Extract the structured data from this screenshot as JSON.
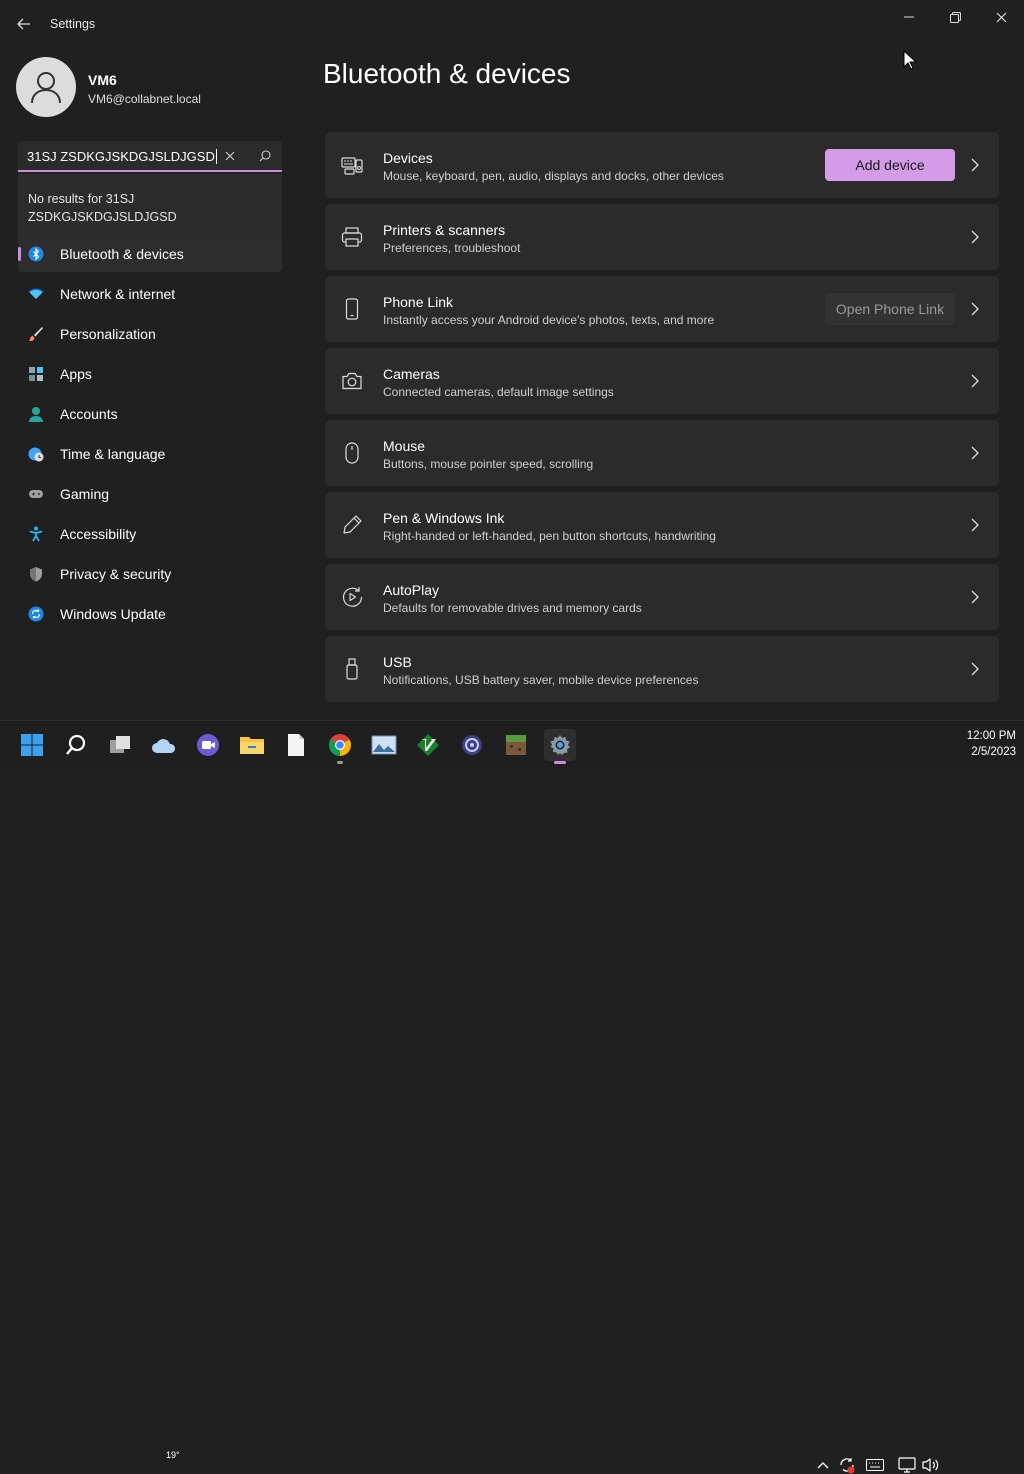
{
  "window": {
    "title": "Settings"
  },
  "user": {
    "name": "VM6",
    "email": "VM6@collabnet.local"
  },
  "search": {
    "value": "31SJ ZSDKGJSKDGJSLDJGSD",
    "no_results": "No results for 31SJ ZSDKGJSKDGJSLDJGSD"
  },
  "nav": [
    {
      "label": "Bluetooth & devices",
      "icon": "bluetooth-icon",
      "selected": true
    },
    {
      "label": "Network & internet",
      "icon": "wifi-icon"
    },
    {
      "label": "Personalization",
      "icon": "brush-icon"
    },
    {
      "label": "Apps",
      "icon": "apps-icon"
    },
    {
      "label": "Accounts",
      "icon": "person-icon"
    },
    {
      "label": "Time & language",
      "icon": "globe-clock-icon"
    },
    {
      "label": "Gaming",
      "icon": "gamepad-icon"
    },
    {
      "label": "Accessibility",
      "icon": "accessibility-icon"
    },
    {
      "label": "Privacy & security",
      "icon": "shield-icon"
    },
    {
      "label": "Windows Update",
      "icon": "update-icon"
    }
  ],
  "page": {
    "title": "Bluetooth & devices"
  },
  "cards": [
    {
      "title": "Devices",
      "subtitle": "Mouse, keyboard, pen, audio, displays and docks, other devices",
      "button": "Add device",
      "icon": "devices-icon"
    },
    {
      "title": "Printers & scanners",
      "subtitle": "Preferences, troubleshoot",
      "icon": "printer-icon"
    },
    {
      "title": "Phone Link",
      "subtitle": "Instantly access your Android device's photos, texts, and more",
      "button": "Open Phone Link",
      "icon": "phone-icon"
    },
    {
      "title": "Cameras",
      "subtitle": "Connected cameras, default image settings",
      "icon": "camera-icon"
    },
    {
      "title": "Mouse",
      "subtitle": "Buttons, mouse pointer speed, scrolling",
      "icon": "mouse-icon"
    },
    {
      "title": "Pen & Windows Ink",
      "subtitle": "Right-handed or left-handed, pen button shortcuts, handwriting",
      "icon": "pen-icon"
    },
    {
      "title": "AutoPlay",
      "subtitle": "Defaults for removable drives and memory cards",
      "icon": "autoplay-icon"
    },
    {
      "title": "USB",
      "subtitle": "Notifications, USB battery saver, mobile device preferences",
      "icon": "usb-icon"
    }
  ],
  "taskbar": {
    "weather_temp": "19°",
    "time": "12:00 PM",
    "date": "2/5/2023"
  },
  "colors": {
    "accent": "#c98ce0",
    "button_accent": "#d39be8",
    "background": "#202020",
    "card": "#2b2b2b"
  }
}
